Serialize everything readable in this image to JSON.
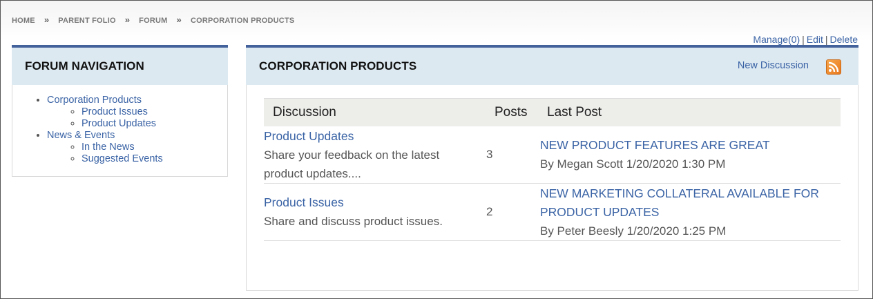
{
  "breadcrumb": {
    "items": [
      "HOME",
      "PARENT FOLIO",
      "FORUM",
      "CORPORATION PRODUCTS"
    ],
    "separator": "»"
  },
  "manage": {
    "manage": "Manage(0)",
    "edit": "Edit",
    "delete": "Delete",
    "divider": "|"
  },
  "nav": {
    "title": "FORUM NAVIGATION",
    "groups": [
      {
        "label": "Corporation Products",
        "children": [
          "Product Issues",
          "Product Updates"
        ]
      },
      {
        "label": "News & Events",
        "children": [
          "In the News",
          "Suggested Events"
        ]
      }
    ]
  },
  "main": {
    "title": "CORPORATION PRODUCTS",
    "new_discussion": "New Discussion",
    "rss_icon": "rss-feed-icon",
    "table": {
      "headers": {
        "discussion": "Discussion",
        "posts": "Posts",
        "last_post": "Last Post"
      },
      "rows": [
        {
          "title": "Product Updates",
          "description": "Share your feedback on the latest product updates....",
          "posts": "3",
          "last_title": "NEW PRODUCT FEATURES ARE GREAT",
          "last_meta": "By Megan Scott 1/20/2020 1:30 PM"
        },
        {
          "title": "Product Issues",
          "description": "Share and discuss product issues.",
          "posts": "2",
          "last_title": "NEW MARKETING COLLATERAL AVAILABLE FOR PRODUCT UPDATES",
          "last_meta": "By Peter Beesly 1/20/2020 1:25 PM"
        }
      ]
    }
  },
  "colors": {
    "accent": "#43629b",
    "header_bg": "#dde9f1",
    "link": "#3a63a5"
  }
}
